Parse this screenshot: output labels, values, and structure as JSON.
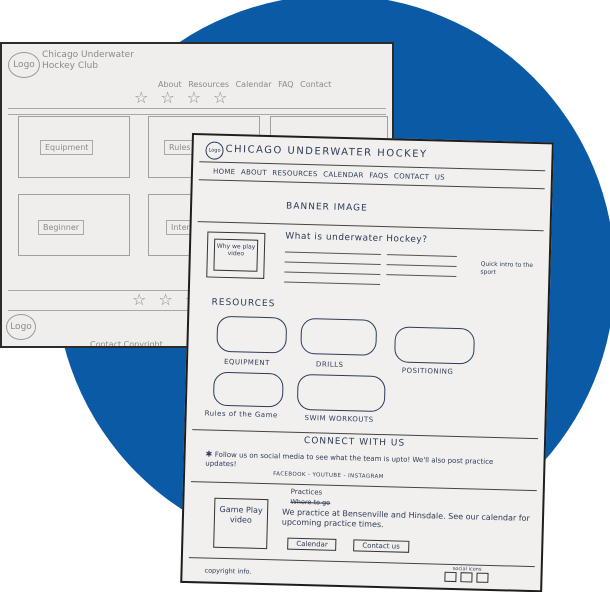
{
  "sketch1": {
    "logo": "Logo",
    "title": "Chicago Underwater Hockey Club",
    "nav": "About Resources Calendar FAQ Contact",
    "stars": "☆☆☆☆",
    "boxes": [
      "Equipment",
      "Rules",
      "Beginner",
      "Intermediate"
    ],
    "footer": "Contact  Copyright",
    "logo_bottom": "Logo"
  },
  "sketch2": {
    "logo": "Logo",
    "title": "CHICAGO UNDERWATER HOCKEY",
    "nav": "HOME ABOUT RESOURCES CALENDAR FAQS CONTACT US",
    "banner": "BANNER IMAGE",
    "video_label": "Why we play video",
    "what_heading": "What is underwater Hockey?",
    "quick_intro": "Quick intro to the sport",
    "resources_heading": "RESOURCES",
    "resources": [
      "EQUIPMENT",
      "DRILLS",
      "POSITIONING",
      "Rules of the Game",
      "SWIM WORKOUTS"
    ],
    "connect_heading": "CONNECT WITH US",
    "follow_text": "Follow us on social media to see what the team is upto! We'll also post practice updates!",
    "social_links": "FACEBOOK - YOUTUBE - INSTAGRAM",
    "game_video": "Game Play video",
    "practices_heading": "Practices",
    "where_struck": "Where to go",
    "practice_text": "We practice at Bensenville and Hinsdale. See our calendar for upcoming practice times.",
    "calendar_button": "Calendar",
    "contact_button": "Contact us",
    "copyright": "copyright info.",
    "social_icons_label": "social icons"
  }
}
